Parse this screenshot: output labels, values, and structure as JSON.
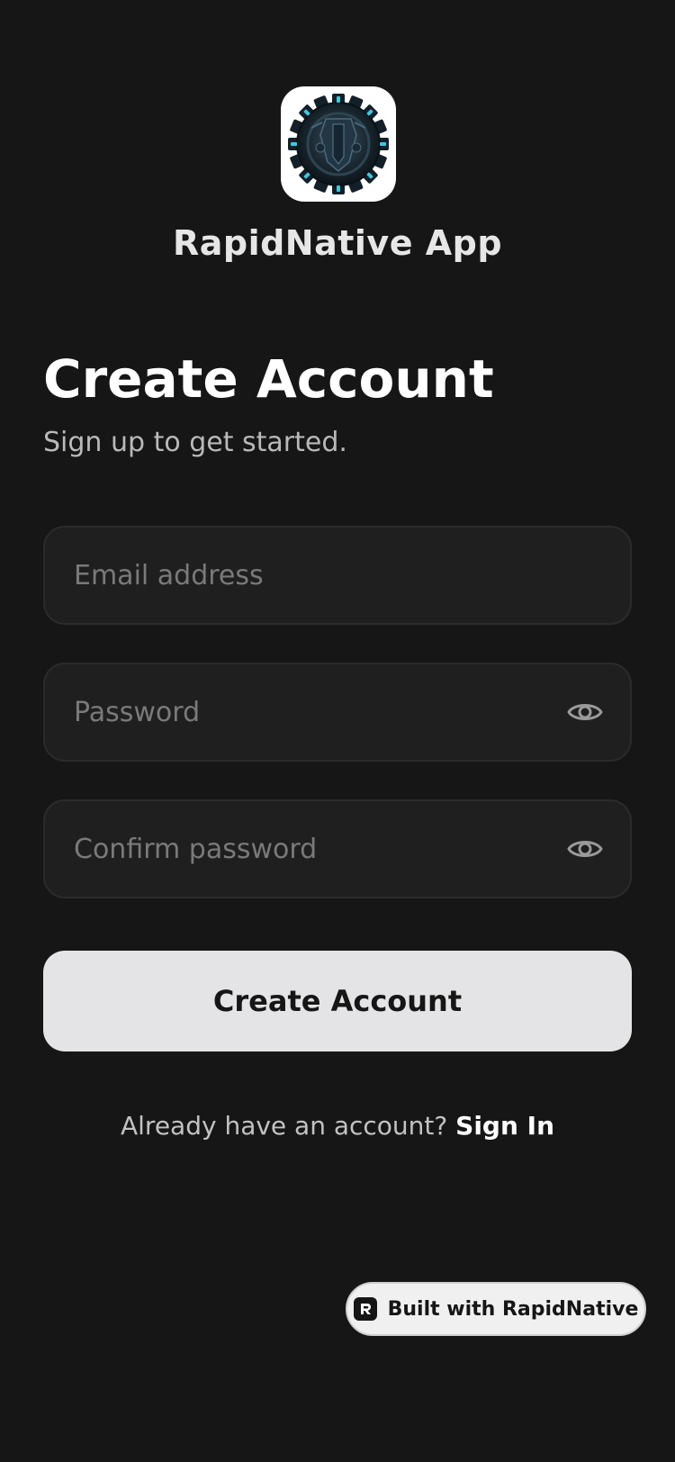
{
  "app": {
    "name": "RapidNative App",
    "icon": "gear-emblem-icon"
  },
  "header": {
    "title": "Create Account",
    "subtitle": "Sign up to get started."
  },
  "form": {
    "email": {
      "value": "",
      "placeholder": "Email address"
    },
    "password": {
      "value": "",
      "placeholder": "Password",
      "toggle_icon": "eye-icon"
    },
    "confirm_password": {
      "value": "",
      "placeholder": "Confirm password",
      "toggle_icon": "eye-icon"
    },
    "submit_label": "Create Account"
  },
  "footer": {
    "prompt": "Already have an account?",
    "link_label": "Sign In"
  },
  "badge": {
    "label": "Built with RapidNative",
    "icon": "rapidnative-logo-icon"
  },
  "colors": {
    "background": "#161616",
    "field_background": "#1f1f1f",
    "button_background": "#e4e4e6",
    "accent_cyan": "#3cc8e0"
  }
}
